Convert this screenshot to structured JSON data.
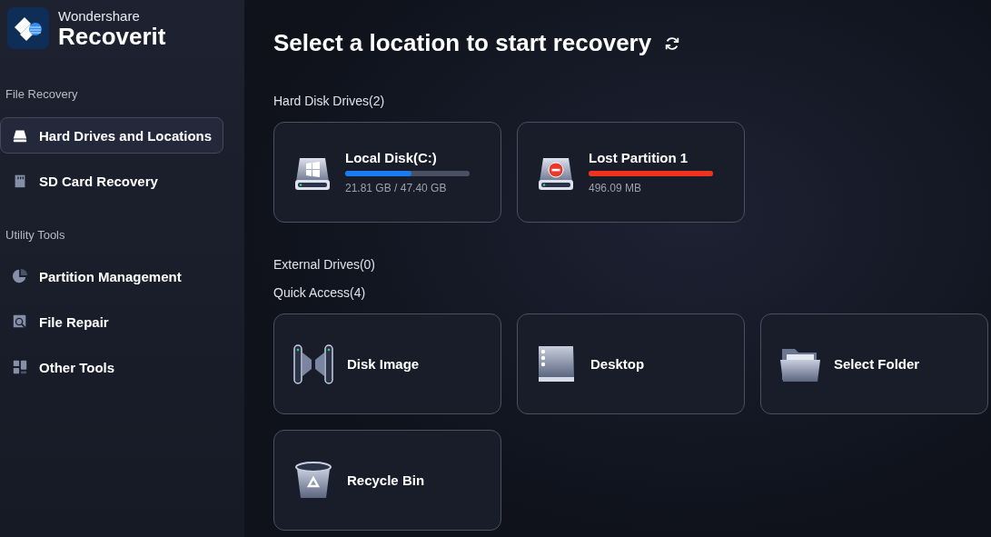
{
  "brand": {
    "company": "Wondershare",
    "product": "Recoverit"
  },
  "sidebar": {
    "sections": [
      {
        "heading": "File Recovery",
        "items": [
          {
            "label": "Hard Drives and Locations",
            "kind": "drive",
            "selected": true
          },
          {
            "label": "SD Card Recovery",
            "kind": "sdcard",
            "selected": false
          }
        ]
      },
      {
        "heading": "Utility Tools",
        "items": [
          {
            "label": "Partition Management",
            "kind": "pie",
            "selected": false
          },
          {
            "label": "File Repair",
            "kind": "repair",
            "selected": false
          },
          {
            "label": "Other Tools",
            "kind": "tiles",
            "selected": false
          }
        ]
      }
    ]
  },
  "title": "Select a location to start recovery",
  "hard_disk_drives": {
    "heading": "Hard Disk Drives(2)",
    "drives": [
      {
        "name": "Local Disk(C:)",
        "kind": "windows",
        "level": 0.53,
        "color": "#1a7cf5",
        "size": "21.81 GB / 47.40 GB"
      },
      {
        "name": "Lost Partition 1",
        "kind": "lost",
        "level": 1,
        "color": "#f0321e",
        "size": "496.09 MB"
      }
    ]
  },
  "external_drives": {
    "heading": "External Drives(0)"
  },
  "quick_access": {
    "heading": "Quick Access(4)",
    "items": [
      {
        "label": "Disk Image",
        "kind": "disk-image"
      },
      {
        "label": "Desktop",
        "kind": "desktop"
      },
      {
        "label": "Select Folder",
        "kind": "folder"
      },
      {
        "label": "Recycle Bin",
        "kind": "bin"
      }
    ]
  }
}
